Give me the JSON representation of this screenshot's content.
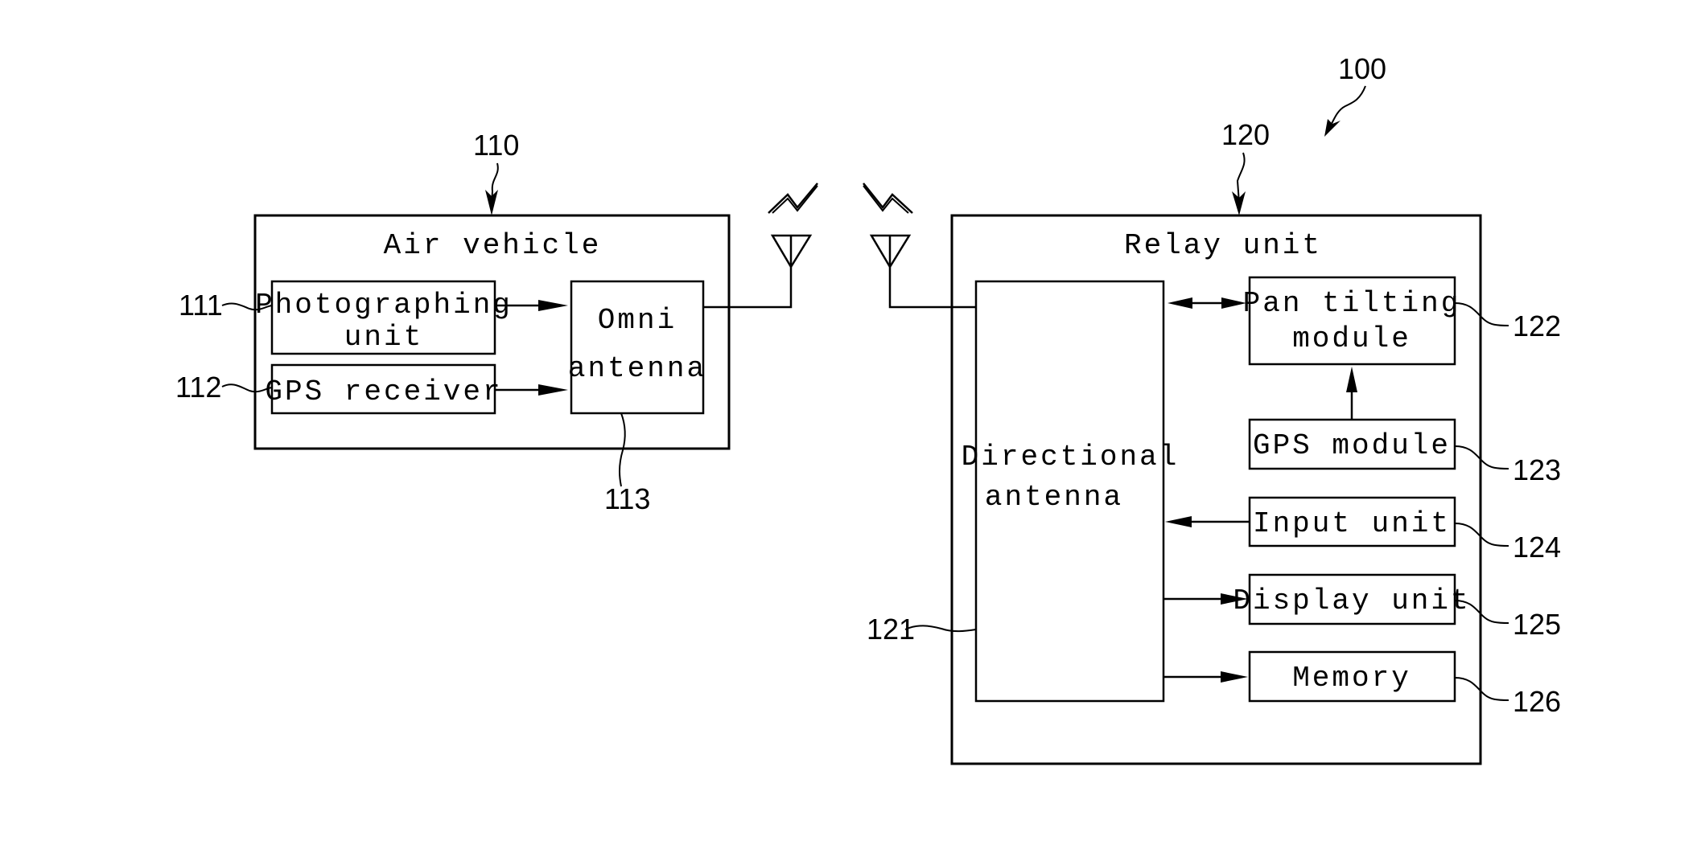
{
  "figure": {
    "system_ref": "100",
    "air_vehicle": {
      "ref": "110",
      "title": "Air vehicle",
      "components": [
        {
          "ref": "111",
          "lines": [
            "Photographing",
            "unit"
          ]
        },
        {
          "ref": "112",
          "lines": [
            "GPS receiver"
          ]
        },
        {
          "ref": "113",
          "lines": [
            "Omni",
            "antenna"
          ]
        }
      ]
    },
    "relay_unit": {
      "ref": "120",
      "title": "Relay unit",
      "components": [
        {
          "ref": "121",
          "lines": [
            "Directional",
            "antenna"
          ]
        },
        {
          "ref": "122",
          "lines": [
            "Pan tilting",
            "module"
          ]
        },
        {
          "ref": "123",
          "lines": [
            "GPS module"
          ]
        },
        {
          "ref": "124",
          "lines": [
            "Input unit"
          ]
        },
        {
          "ref": "125",
          "lines": [
            "Display unit"
          ]
        },
        {
          "ref": "126",
          "lines": [
            "Memory"
          ]
        }
      ]
    },
    "connections": [
      {
        "from": "Photographing unit",
        "to": "Omni antenna",
        "direction": "one-way"
      },
      {
        "from": "GPS receiver",
        "to": "Omni antenna",
        "direction": "one-way"
      },
      {
        "from": "Omni antenna",
        "to": "Directional antenna",
        "direction": "wireless"
      },
      {
        "from": "Directional antenna",
        "to": "Pan tilting module",
        "direction": "two-way"
      },
      {
        "from": "GPS module",
        "to": "Pan tilting module",
        "direction": "one-way"
      },
      {
        "from": "Input unit",
        "to": "Directional antenna",
        "direction": "one-way"
      },
      {
        "from": "Directional antenna",
        "to": "Display unit",
        "direction": "one-way"
      },
      {
        "from": "Directional antenna",
        "to": "Memory",
        "direction": "one-way"
      }
    ],
    "icons": [
      "antenna-icon",
      "wireless-signal-icon"
    ]
  }
}
